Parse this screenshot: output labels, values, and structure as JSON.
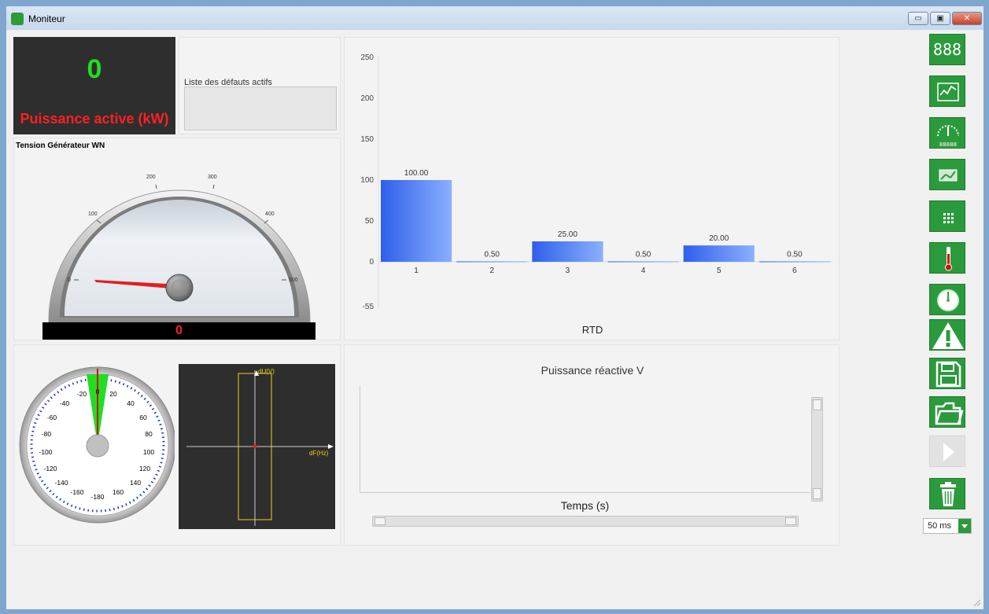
{
  "window": {
    "title": "Moniteur",
    "minimize_label": "▭",
    "maximize_label": "▣",
    "close_label": "✕"
  },
  "power_display": {
    "value": "0",
    "label": "Puissance active (kW)"
  },
  "fault_list": {
    "label": "Liste des défauts actifs",
    "value": ""
  },
  "voltage_gauge": {
    "title": "Tension Générateur WN",
    "ticks": [
      "0",
      "100",
      "200",
      "300",
      "400",
      "500"
    ],
    "value": "0",
    "min": 0,
    "max": 500
  },
  "bar_chart": {
    "xlabel": "RTD",
    "y_ticks": [
      "250",
      "200",
      "150",
      "100",
      "50",
      "0",
      "-55"
    ]
  },
  "chart_data": {
    "type": "bar",
    "categories": [
      "1",
      "2",
      "3",
      "4",
      "5",
      "6"
    ],
    "values": [
      100.0,
      0.5,
      25.0,
      0.5,
      20.0,
      0.5
    ],
    "value_labels": [
      "100.00",
      "0.50",
      "25.00",
      "0.50",
      "20.00",
      "0.50"
    ],
    "title": "",
    "xlabel": "RTD",
    "ylabel": "",
    "ylim": [
      -55,
      250
    ],
    "color": "#3f73f0"
  },
  "phase_gauge": {
    "labels_left": [
      "-20",
      "-40",
      "-60",
      "-80",
      "-100",
      "-120",
      "-140",
      "-160"
    ],
    "labels_right": [
      "20",
      "40",
      "60",
      "80",
      "100",
      "120",
      "140",
      "160"
    ],
    "label_zero": "0",
    "label_bottom": "-180"
  },
  "sync_scope": {
    "y_label": "dU(V)",
    "x_label": "dF(Hz)"
  },
  "reactive_chart": {
    "title": "Puissance réactive V",
    "xlabel": "Temps (s)"
  },
  "sidebar": {
    "digital_label": "888",
    "gauge_caption": "88888",
    "interval": "50 ms"
  },
  "colors": {
    "accent_green": "#2b9a3c",
    "power_value": "#22dd22",
    "power_label": "#ff2020",
    "bar": "#3f73f0"
  }
}
